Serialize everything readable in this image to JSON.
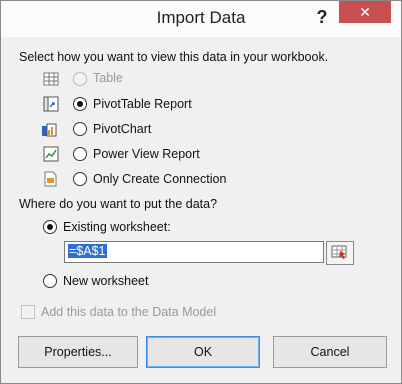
{
  "window": {
    "title": "Import Data",
    "help_glyph": "?",
    "close_glyph": "✕"
  },
  "view_section": {
    "prompt": "Select how you want to view this data in your workbook.",
    "options": [
      {
        "label": "Table",
        "selected": false,
        "enabled": false,
        "icon": "table-icon"
      },
      {
        "label": "PivotTable Report",
        "selected": true,
        "enabled": true,
        "icon": "pivottable-icon"
      },
      {
        "label": "PivotChart",
        "selected": false,
        "enabled": true,
        "icon": "pivotchart-icon"
      },
      {
        "label": "Power View Report",
        "selected": false,
        "enabled": true,
        "icon": "power-view-icon"
      },
      {
        "label": "Only Create Connection",
        "selected": false,
        "enabled": true,
        "icon": "connection-icon"
      }
    ]
  },
  "location_section": {
    "prompt": "Where do you want to put the data?",
    "existing_label": "Existing worksheet:",
    "existing_selected": true,
    "cell_ref_value": "=$A$1",
    "new_label": "New worksheet",
    "new_selected": false
  },
  "data_model": {
    "label": "Add this data to the Data Model",
    "checked": false,
    "enabled": false
  },
  "buttons": {
    "properties": "Properties...",
    "ok": "OK",
    "cancel": "Cancel"
  },
  "colors": {
    "close_button": "#c74f4f",
    "selection": "#2f6fd3",
    "focus_border": "#3a8ee6"
  }
}
